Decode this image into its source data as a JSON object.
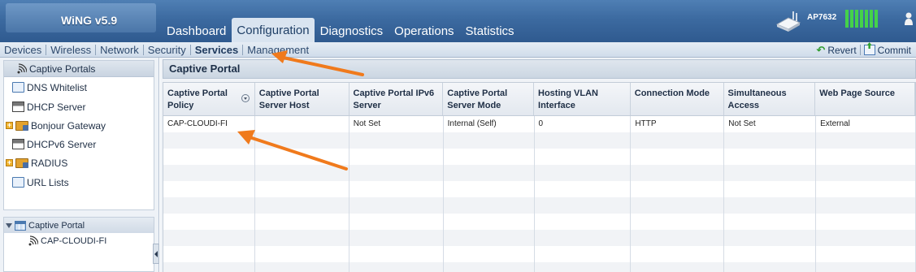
{
  "app": {
    "logo": "WiNG v5.9"
  },
  "main_tabs": [
    {
      "label": "Dashboard",
      "active": false
    },
    {
      "label": "Configuration",
      "active": true
    },
    {
      "label": "Diagnostics",
      "active": false
    },
    {
      "label": "Operations",
      "active": false
    },
    {
      "label": "Statistics",
      "active": false
    }
  ],
  "device": {
    "name": "AP7632"
  },
  "subnav": {
    "items": [
      "Devices",
      "Wireless",
      "Network",
      "Security",
      "Services",
      "Management"
    ],
    "active": "Services",
    "revert_label": "Revert",
    "commit_label": "Commit"
  },
  "sidebar": {
    "header": "Captive Portals",
    "items": [
      {
        "label": "DNS Whitelist",
        "icon": "document-icon"
      },
      {
        "label": "DHCP Server",
        "icon": "server-icon"
      },
      {
        "label": "Bonjour Gateway",
        "icon": "folder-icon",
        "expandable": true
      },
      {
        "label": "DHCPv6 Server",
        "icon": "server-icon"
      },
      {
        "label": "RADIUS",
        "icon": "folder-icon",
        "expandable": true
      },
      {
        "label": "URL Lists",
        "icon": "document-icon"
      }
    ],
    "tree_header": "Captive Portal",
    "tree_child": "CAP-CLOUDI-FI"
  },
  "panel": {
    "title": "Captive Portal",
    "columns": [
      "Captive Portal Policy",
      "Captive Portal Server Host",
      "Captive Portal IPv6 Server",
      "Captive Portal Server Mode",
      "Hosting VLAN Interface",
      "Connection Mode",
      "Simultaneous Access",
      "Web Page Source"
    ],
    "rows": [
      [
        "CAP-CLOUDI-FI",
        "",
        "Not Set",
        "Internal (Self)",
        "0",
        "HTTP",
        "Not Set",
        "External"
      ]
    ]
  },
  "colors": {
    "accent_arrow": "#f07a1c",
    "header_blue": "#3c6aa0",
    "signal_green": "#44d24a"
  }
}
